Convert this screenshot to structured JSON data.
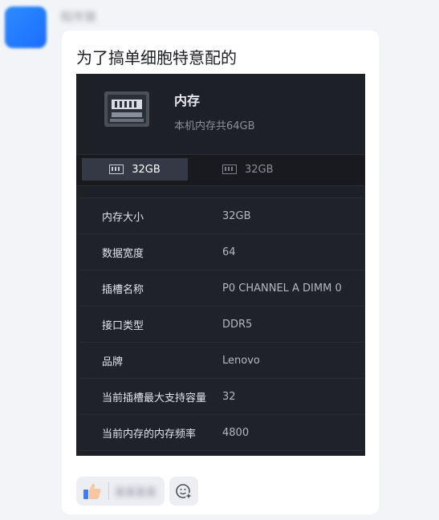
{
  "chat": {
    "sender": "程序猿",
    "message": "为了搞单细胞特意配的"
  },
  "memory_panel": {
    "title": "内存",
    "subtitle": "本机内存共64GB",
    "tabs": [
      {
        "label": "32GB",
        "active": true
      },
      {
        "label": "32GB",
        "active": false
      }
    ],
    "rows": [
      {
        "key": "内存大小",
        "value": "32GB"
      },
      {
        "key": "数据宽度",
        "value": "64"
      },
      {
        "key": "插槽名称",
        "value": "P0 CHANNEL A DIMM 0"
      },
      {
        "key": "接口类型",
        "value": "DDR5"
      },
      {
        "key": "品牌",
        "value": "Lenovo"
      },
      {
        "key": "当前插槽最大支持容量",
        "value": "32"
      },
      {
        "key": "当前内存的内存频率",
        "value": "4800"
      }
    ]
  },
  "reactions": {
    "like_icon": "thumbs-up-icon",
    "names": "某某某某",
    "add_icon": "emoji-add-icon"
  }
}
